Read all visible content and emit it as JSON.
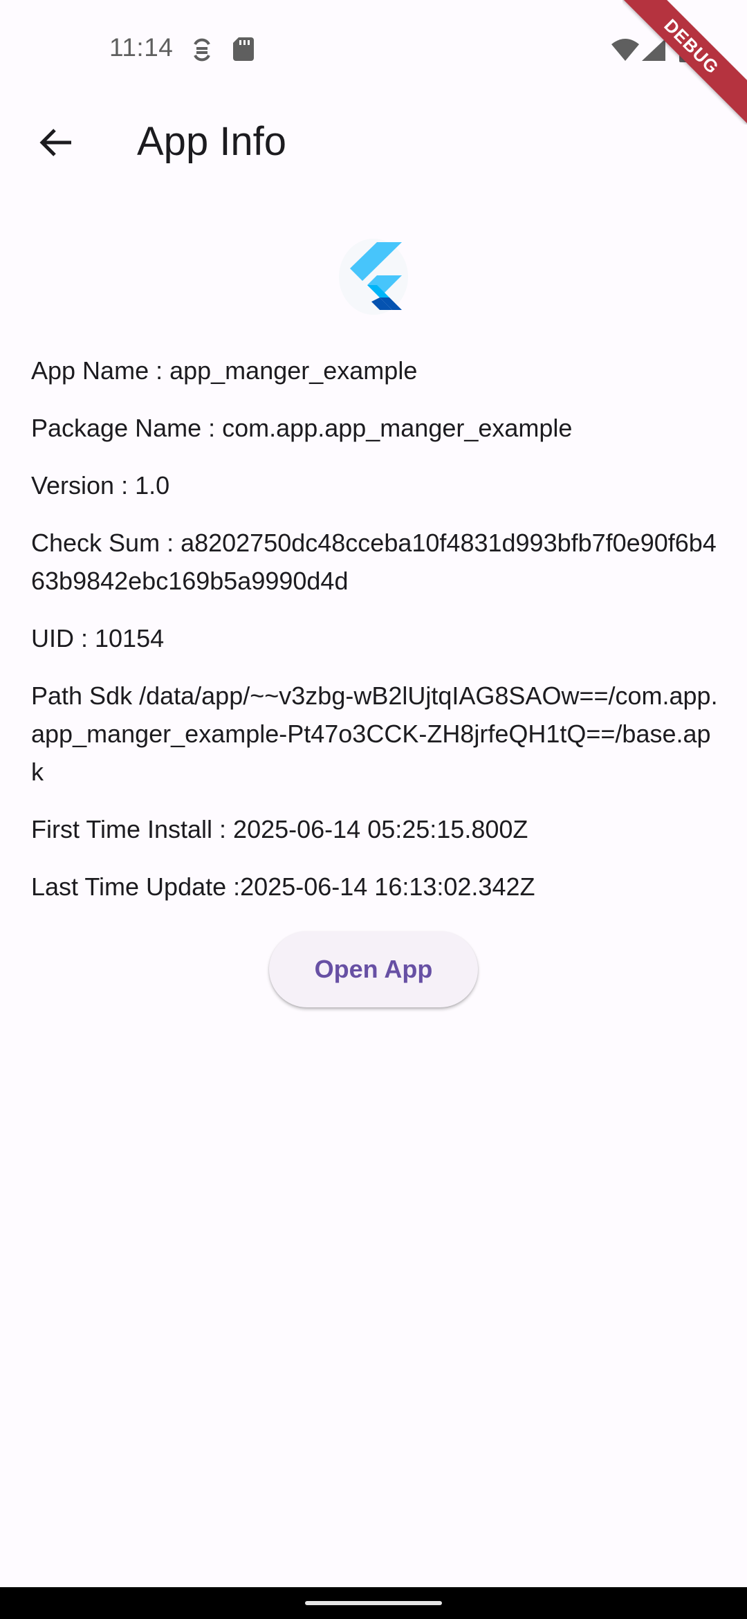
{
  "status_bar": {
    "time": "11:14",
    "left_icons": [
      "sync-icon",
      "sd-card-icon"
    ],
    "right_icons": [
      "wifi-icon",
      "cell-signal-icon",
      "battery-icon"
    ]
  },
  "debug_banner": {
    "label": "DEBUG",
    "color": "#b5333f"
  },
  "app_bar": {
    "back_icon": "arrow-back-icon",
    "title": "App Info"
  },
  "app_logo": {
    "icon": "flutter-logo-icon",
    "colors": [
      "#47c5fb",
      "#0553b1",
      "#00b5f8"
    ]
  },
  "info": {
    "app_name": "App Name : app_manger_example",
    "package_name": "Package Name : com.app.app_manger_example",
    "version": "Version : 1.0",
    "check_sum": "Check Sum : a8202750dc48cceba10f4831d993bfb7f0e90f6b463b9842ebc169b5a9990d4d",
    "uid": "UID : 10154",
    "path_sdk": "Path Sdk /data/app/~~v3zbg-wB2lUjtqIAG8SAOw==/com.app.app_manger_example-Pt47o3CCK-ZH8jrfeQH1tQ==/base.apk",
    "first_install": "First Time Install : 2025-06-14 05:25:15.800Z",
    "last_update": "Last Time Update :2025-06-14 16:13:02.342Z"
  },
  "actions": {
    "open_app_label": "Open App",
    "accent_color": "#6750a4"
  }
}
